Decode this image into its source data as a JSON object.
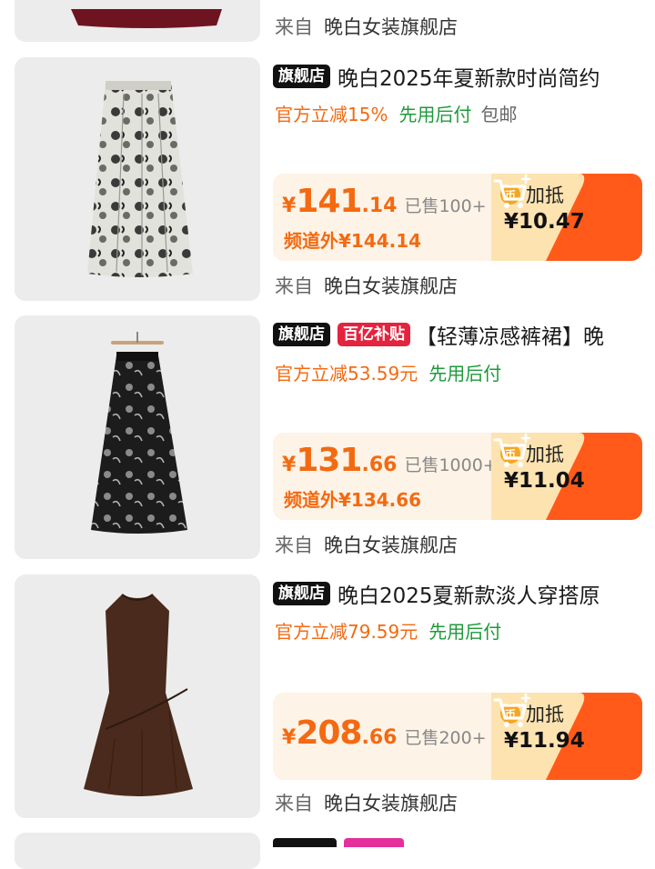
{
  "top_item": {
    "shop_from": "来自",
    "shop_name": "晚白女装旗舰店"
  },
  "products": [
    {
      "tags": [
        "旗舰店"
      ],
      "title": "晚白2025年夏新款时尚简约",
      "promo_discount": "官方立减15%",
      "promo_pay_later": "先用后付",
      "promo_shipping": "包邮",
      "price_yen": "¥",
      "price_int": "141",
      "price_dec": ".14",
      "sold": "已售100+",
      "external_price": "频道外¥144.14",
      "coupon_label": "加抵",
      "coupon_value": "¥10.47",
      "shop_from": "来自",
      "shop_name": "晚白女装旗舰店"
    },
    {
      "tags": [
        "旗舰店",
        "百亿补贴"
      ],
      "title": "【轻薄凉感裤裙】晚",
      "promo_discount": "官方立减53.59元",
      "promo_pay_later": "先用后付",
      "price_yen": "¥",
      "price_int": "131",
      "price_dec": ".66",
      "sold": "已售1000+",
      "external_price": "频道外¥134.66",
      "coupon_label": "加抵",
      "coupon_value": "¥11.04",
      "shop_from": "来自",
      "shop_name": "晚白女装旗舰店"
    },
    {
      "tags": [
        "旗舰店"
      ],
      "title": "晚白2025夏新款淡人穿搭原",
      "promo_discount": "官方立减79.59元",
      "promo_pay_later": "先用后付",
      "price_yen": "¥",
      "price_int": "208",
      "price_dec": ".66",
      "sold": "已售200+",
      "coupon_label": "加抵",
      "coupon_value": "¥11.94",
      "shop_from": "来自",
      "shop_name": "晚白女装旗舰店"
    }
  ],
  "icons": {
    "coin": "coin-icon",
    "cart": "add-to-cart-icon"
  },
  "colors": {
    "price_orange": "#f36a12",
    "promo_green": "#1f9a3b",
    "cart_orange": "#ff5a1a",
    "tag_red": "#e4233e"
  }
}
